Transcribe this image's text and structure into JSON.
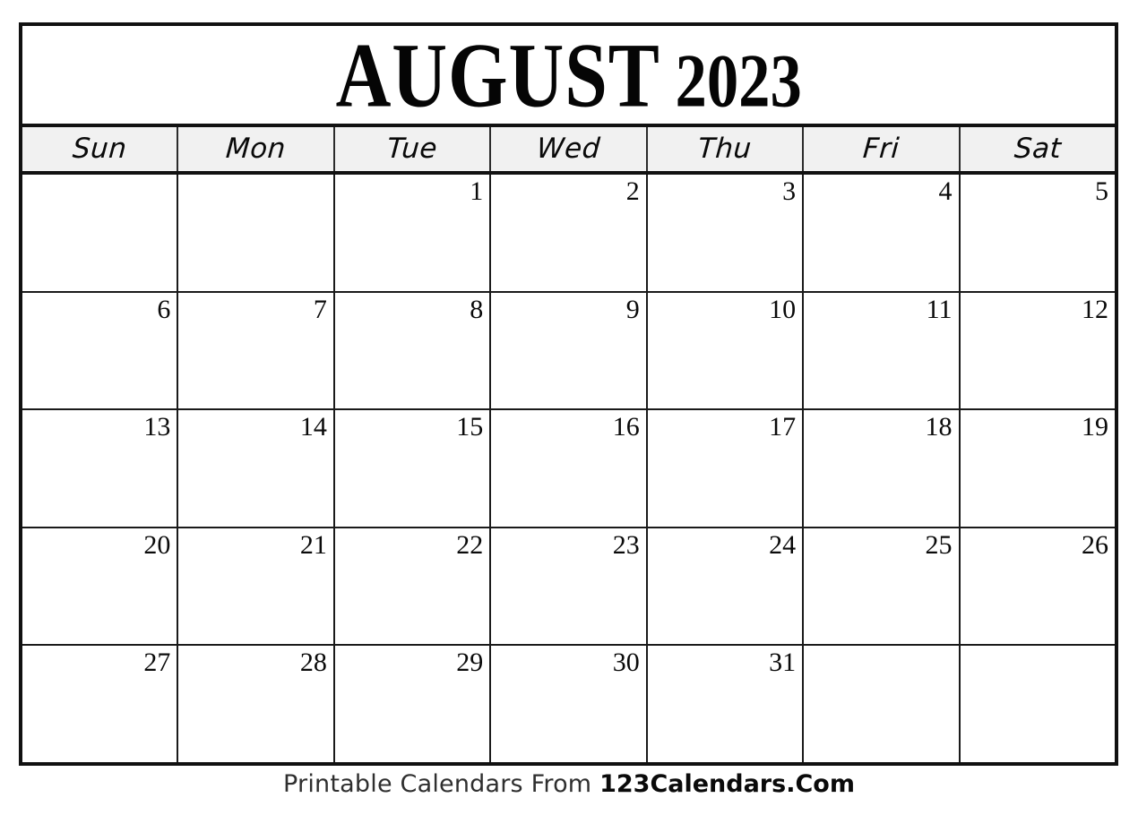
{
  "calendar": {
    "month": "AUGUST",
    "year": "2023",
    "title": "AUGUST 2023",
    "weekdays": [
      "Sun",
      "Mon",
      "Tue",
      "Wed",
      "Thu",
      "Fri",
      "Sat"
    ],
    "weeks": [
      [
        "",
        "",
        "1",
        "2",
        "3",
        "4",
        "5"
      ],
      [
        "6",
        "7",
        "8",
        "9",
        "10",
        "11",
        "12"
      ],
      [
        "13",
        "14",
        "15",
        "16",
        "17",
        "18",
        "19"
      ],
      [
        "20",
        "21",
        "22",
        "23",
        "24",
        "25",
        "26"
      ],
      [
        "27",
        "28",
        "29",
        "30",
        "31",
        "",
        ""
      ]
    ]
  },
  "footer": {
    "prefix": "Printable Calendars From ",
    "brand": "123Calendars.Com"
  },
  "colors": {
    "border": "#111111",
    "grid_line": "#1a1a1a",
    "weekday_band": "#f1f1f1",
    "page_background": "#ffffff",
    "text": "#0a0a0a",
    "footer_text": "#2f2f2f"
  }
}
